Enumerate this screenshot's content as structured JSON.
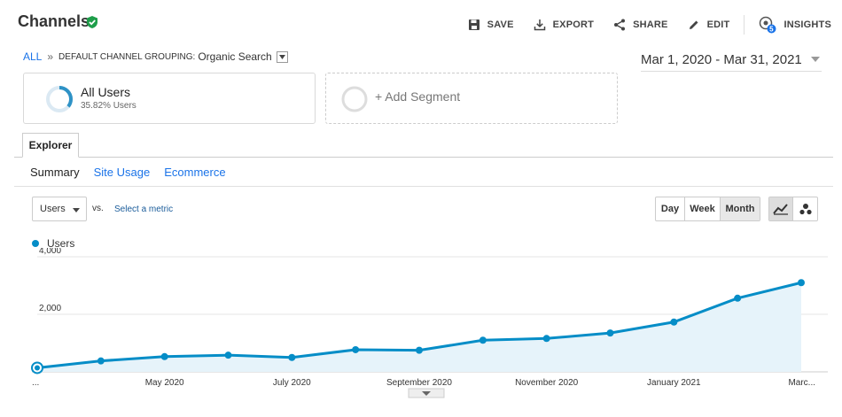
{
  "header": {
    "title": "Channels",
    "actions": [
      {
        "label": "SAVE",
        "icon": "save-icon"
      },
      {
        "label": "EXPORT",
        "icon": "export-icon"
      },
      {
        "label": "SHARE",
        "icon": "share-icon"
      },
      {
        "label": "EDIT",
        "icon": "pencil-icon"
      },
      {
        "label": "INSIGHTS",
        "icon": "insights-icon",
        "badge": "5"
      }
    ]
  },
  "breadcrumb": {
    "all": "ALL",
    "separator": "»",
    "grouping_label": "DEFAULT CHANNEL GROUPING:",
    "grouping_value": "Organic Search"
  },
  "date_range": "Mar 1, 2020 - Mar 31, 2021",
  "segments": {
    "active": {
      "title": "All Users",
      "subtitle": "35.82% Users",
      "share": 0.3582
    },
    "add_label": "+ Add Segment"
  },
  "tabs": {
    "explorer": "Explorer"
  },
  "subtabs": [
    "Summary",
    "Site Usage",
    "Ecommerce"
  ],
  "controls": {
    "metric": "Users",
    "vs": "vs.",
    "select_metric": "Select a metric",
    "periods": [
      "Day",
      "Week",
      "Month"
    ],
    "active_period": "Month"
  },
  "colors": {
    "accent": "#058dc7",
    "fill": "#e6f3fa",
    "link": "#1a73e8"
  },
  "chart_data": {
    "type": "area",
    "series": [
      {
        "name": "Users",
        "values": [
          140,
          380,
          530,
          580,
          500,
          770,
          750,
          1100,
          1160,
          1350,
          1730,
          2560,
          3100
        ]
      }
    ],
    "x": [
      "Mar 2020",
      "Apr 2020",
      "May 2020",
      "Jun 2020",
      "Jul 2020",
      "Aug 2020",
      "Sep 2020",
      "Oct 2020",
      "Nov 2020",
      "Dec 2020",
      "Jan 2021",
      "Feb 2021",
      "Mar 2021"
    ],
    "x_tick_labels": [
      "...",
      "May 2020",
      "July 2020",
      "September 2020",
      "November 2020",
      "January 2021",
      "Marc..."
    ],
    "x_tick_indices": [
      0,
      2,
      4,
      6,
      8,
      10,
      12
    ],
    "y_tick_labels": [
      "2,000",
      "4,000"
    ],
    "y_ticks": [
      2000,
      4000
    ],
    "ylim": [
      0,
      4000
    ],
    "grid": true
  }
}
